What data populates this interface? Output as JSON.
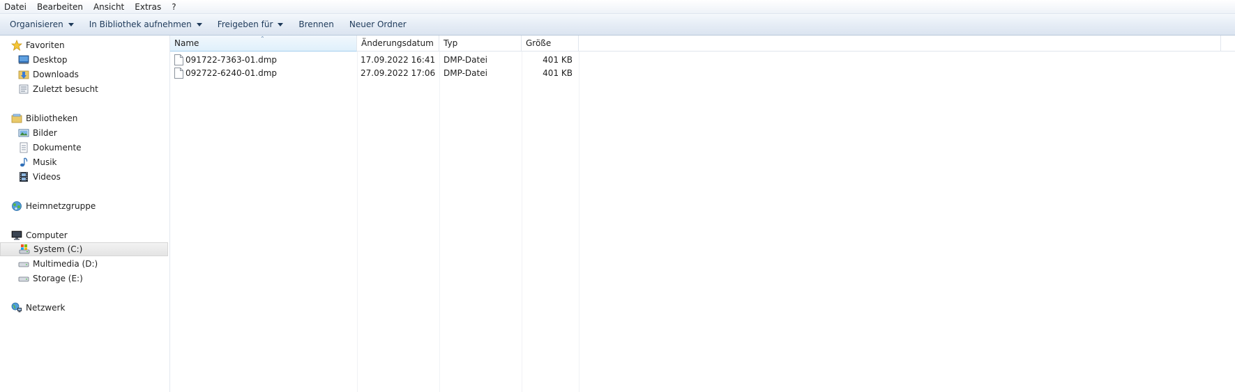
{
  "menu": [
    "Datei",
    "Bearbeiten",
    "Ansicht",
    "Extras",
    "?"
  ],
  "toolbar": {
    "organize": "Organisieren",
    "include_library": "In Bibliothek aufnehmen",
    "share": "Freigeben für",
    "burn": "Brennen",
    "new_folder": "Neuer Ordner"
  },
  "nav": {
    "favorites": "Favoriten",
    "desktop": "Desktop",
    "downloads": "Downloads",
    "recent": "Zuletzt besucht",
    "libraries": "Bibliotheken",
    "pictures": "Bilder",
    "documents": "Dokumente",
    "music": "Musik",
    "videos": "Videos",
    "homegroup": "Heimnetzgruppe",
    "computer": "Computer",
    "drive_c": "System (C:)",
    "drive_d": "Multimedia (D:)",
    "drive_e": "Storage (E:)",
    "network": "Netzwerk"
  },
  "columns": {
    "name": "Name",
    "date": "Änderungsdatum",
    "type": "Typ",
    "size": "Größe"
  },
  "files": [
    {
      "name": "091722-7363-01.dmp",
      "date": "17.09.2022 16:41",
      "type": "DMP-Datei",
      "size": "401 KB"
    },
    {
      "name": "092722-6240-01.dmp",
      "date": "27.09.2022 17:06",
      "type": "DMP-Datei",
      "size": "401 KB"
    }
  ],
  "icons": {
    "favorites": "star-icon",
    "desktop": "desktop-icon",
    "downloads": "downloads-folder-icon",
    "recent": "recent-places-icon",
    "libraries": "library-icon",
    "pictures": "pictures-icon",
    "documents": "documents-icon",
    "music": "music-note-icon",
    "videos": "film-icon",
    "homegroup": "homegroup-icon",
    "computer": "monitor-icon",
    "drive": "hard-drive-icon",
    "network": "network-globe-icon",
    "file": "generic-file-icon"
  },
  "colors": {
    "header_sorted": "#dff0fb",
    "selection": "#e4e4e4",
    "toolbar_text": "#1e3a5a"
  }
}
